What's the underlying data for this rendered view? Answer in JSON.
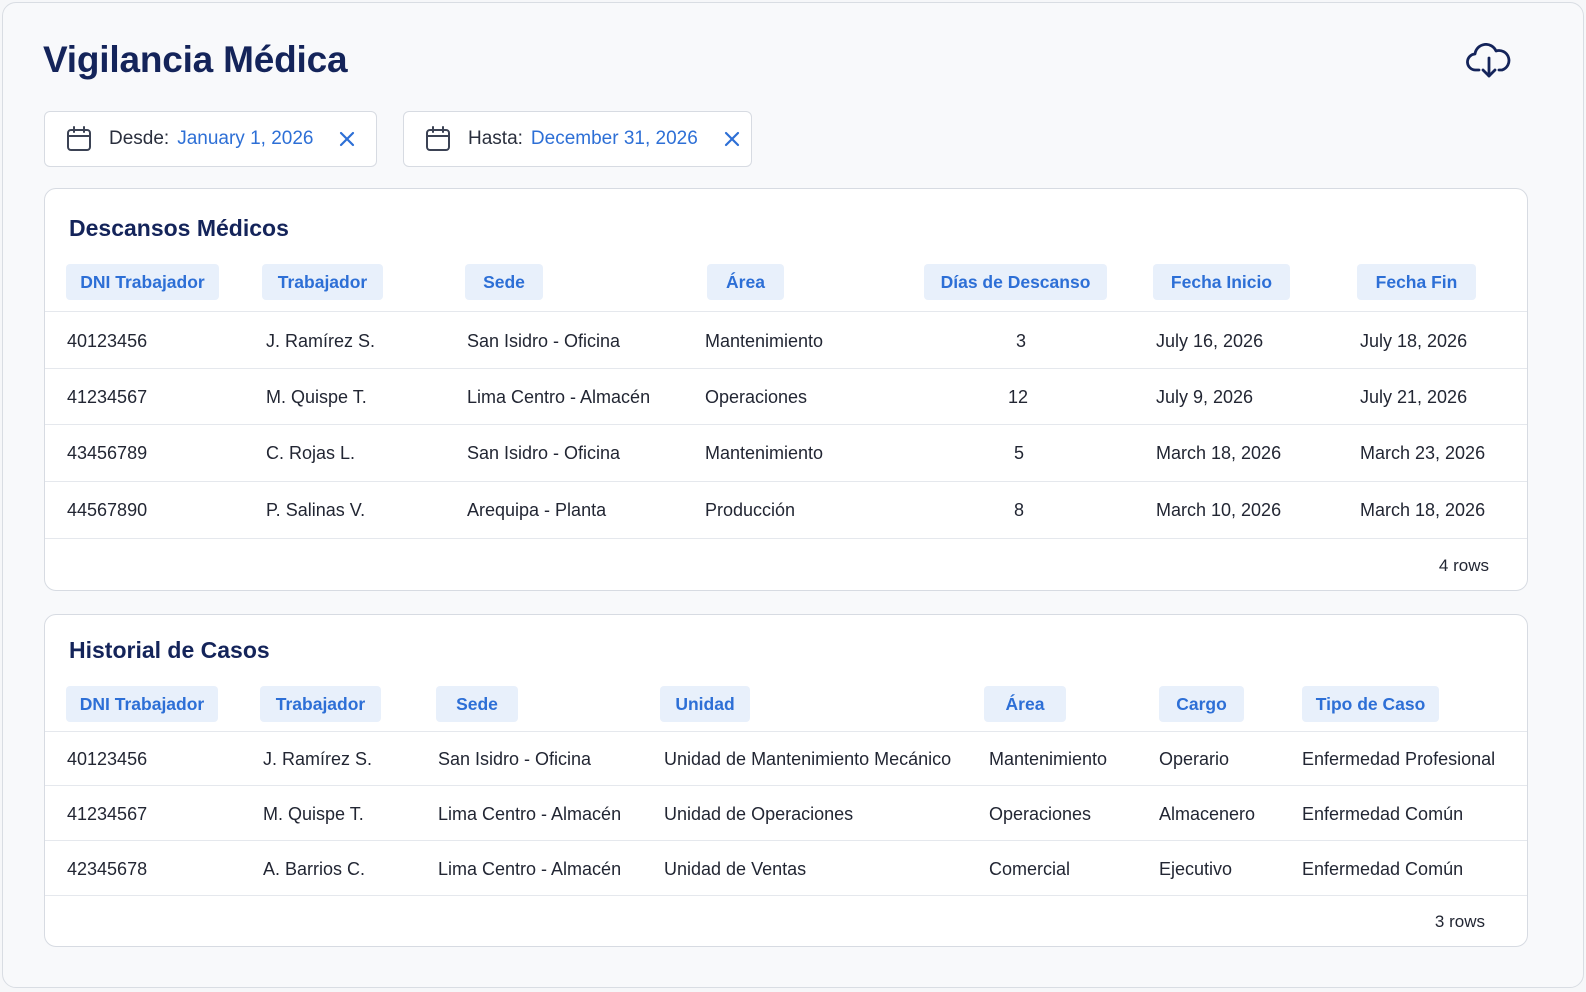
{
  "page": {
    "title": "Vigilancia Médica"
  },
  "filters": {
    "from": {
      "label": "Desde:",
      "value": "January 1, 2026"
    },
    "to": {
      "label": "Hasta:",
      "value": "December 31, 2026"
    }
  },
  "descansos": {
    "title": "Descansos Médicos",
    "columns": [
      "DNI Trabajador",
      "Trabajador",
      "Sede",
      "Área",
      "Días de Descanso",
      "Fecha Inicio",
      "Fecha Fin"
    ],
    "rows": [
      [
        "40123456",
        "J. Ramírez S.",
        "San Isidro - Oficina",
        "Mantenimiento",
        "3",
        "July 16, 2026",
        "July 18, 2026"
      ],
      [
        "41234567",
        "M. Quispe T.",
        "Lima Centro - Almacén",
        "Operaciones",
        "12",
        "July 9, 2026",
        "July 21, 2026"
      ],
      [
        "43456789",
        "C. Rojas L.",
        "San Isidro - Oficina",
        "Mantenimiento",
        "5",
        "March 18, 2026",
        "March 23, 2026"
      ],
      [
        "44567890",
        "P. Salinas V.",
        "Arequipa - Planta",
        "Producción",
        "8",
        "March 10, 2026",
        "March 18, 2026"
      ]
    ],
    "row_count": "4 rows"
  },
  "historial": {
    "title": "Historial de Casos",
    "columns": [
      "DNI Trabajador",
      "Trabajador",
      "Sede",
      "Unidad",
      "Área",
      "Cargo",
      "Tipo de Caso"
    ],
    "rows": [
      [
        "40123456",
        "J. Ramírez S.",
        "San Isidro - Oficina",
        "Unidad de Mantenimiento Mecánico",
        "Mantenimiento",
        "Operario",
        "Enfermedad Profesional"
      ],
      [
        "41234567",
        "M. Quispe T.",
        "Lima Centro - Almacén",
        "Unidad de Operaciones",
        "Operaciones",
        "Almacenero",
        "Enfermedad Común"
      ],
      [
        "42345678",
        "A. Barrios C.",
        "Lima Centro - Almacén",
        "Unidad de Ventas",
        "Comercial",
        "Ejecutivo",
        "Enfermedad Común"
      ]
    ],
    "row_count": "3 rows"
  },
  "icons": {
    "download": "cloud-download-icon",
    "calendar": "calendar-icon",
    "clear": "close-icon"
  },
  "colors": {
    "title": "#14245a",
    "accent": "#2d6fd6",
    "header_pill_bg": "#e8f0fb"
  }
}
